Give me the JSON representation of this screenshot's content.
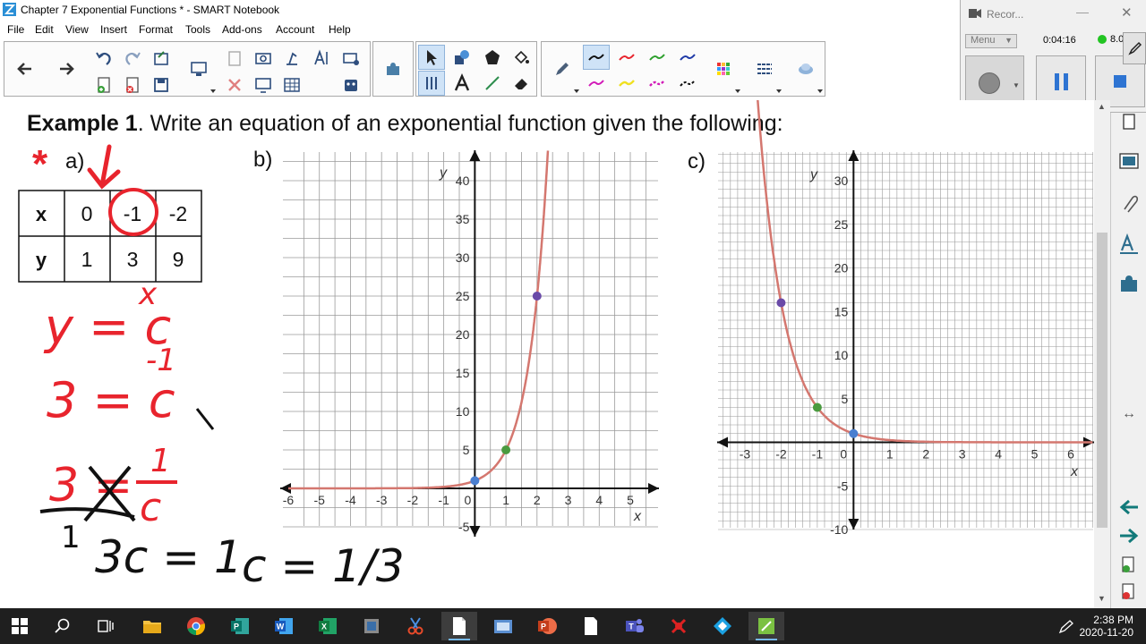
{
  "window": {
    "title": "Chapter 7  Exponential Functions * - SMART Notebook"
  },
  "menu": [
    "File",
    "Edit",
    "View",
    "Insert",
    "Format",
    "Tools",
    "Add-ons",
    "Account",
    "Help"
  ],
  "recorder": {
    "title": "Recor...",
    "menu_label": "Menu",
    "elapsed": "0:04:16",
    "size_label": "8.0"
  },
  "page": {
    "heading_bold": "Example 1",
    "heading_rest": ".  Write an equation of an exponential function given the following:",
    "part_a": "a)",
    "part_b": "b)",
    "part_c": "c)",
    "asterisk": "*",
    "table": {
      "rows": [
        {
          "label": "x",
          "cells": [
            "0",
            "-1",
            "-2"
          ]
        },
        {
          "label": "y",
          "cells": [
            "1",
            "3",
            "9"
          ]
        }
      ]
    },
    "handwriting": {
      "line1": "y = c",
      "line1_exp": "x",
      "line2": "3 = c",
      "line2_exp": "-1",
      "line3_left": "3 =",
      "line3_num": "1",
      "line3_den": "c",
      "line4": "3c = 1",
      "mark_1": "1",
      "result": "c = 1/3"
    }
  },
  "chart_data": [
    {
      "type": "line",
      "panel": "b)",
      "title": "",
      "xlabel": "x",
      "ylabel": "y",
      "xlim": [
        -6,
        5
      ],
      "ylim": [
        -5,
        40
      ],
      "x_ticks": [
        "-6",
        "-5",
        "-4",
        "-3",
        "-2",
        "-1",
        "0",
        "1",
        "2",
        "3",
        "4",
        "5"
      ],
      "y_ticks": [
        "-5",
        "5",
        "10",
        "15",
        "20",
        "25",
        "30",
        "35",
        "40"
      ],
      "grid": true,
      "curve": {
        "function": "5^x",
        "color": "#d4776f"
      },
      "points": [
        {
          "x": 0,
          "y": 1,
          "color": "#4a7fd0"
        },
        {
          "x": 1,
          "y": 5,
          "color": "#4a9a3f"
        },
        {
          "x": 2,
          "y": 25,
          "color": "#6a4aa8"
        }
      ]
    },
    {
      "type": "line",
      "panel": "c)",
      "title": "",
      "xlabel": "x",
      "ylabel": "y",
      "xlim": [
        -3,
        6
      ],
      "ylim": [
        -10,
        30
      ],
      "x_ticks": [
        "-3",
        "-2",
        "-1",
        "0",
        "1",
        "2",
        "3",
        "4",
        "5",
        "6"
      ],
      "y_ticks": [
        "-10",
        "-5",
        "5",
        "10",
        "15",
        "20",
        "25",
        "30"
      ],
      "grid": true,
      "curve": {
        "function": "(1/4)^x",
        "color": "#d4776f"
      },
      "points": [
        {
          "x": -2,
          "y": 16,
          "color": "#6a4aa8"
        },
        {
          "x": -1,
          "y": 4,
          "color": "#4a9a3f"
        },
        {
          "x": 0,
          "y": 1,
          "color": "#4a7fd0"
        }
      ]
    }
  ],
  "taskbar": {
    "time": "2:38 PM",
    "date": "2020-11-20",
    "icons": [
      "start-icon",
      "search-icon",
      "task-view-icon",
      "file-explorer-icon",
      "chrome-icon",
      "publisher-icon",
      "word-icon",
      "excel-icon",
      "ink-app-icon",
      "snipping-icon",
      "smart-notebook-icon",
      "snap-icon",
      "powerpoint-icon",
      "notepad-icon",
      "teams-icon",
      "flash-icon",
      "vscode-diamond-icon",
      "green-app-icon"
    ]
  },
  "colors": {
    "ink_red": "#e8242d",
    "ink_black": "#111111",
    "curve": "#d4776f",
    "accent_blue": "#2e74d2"
  }
}
